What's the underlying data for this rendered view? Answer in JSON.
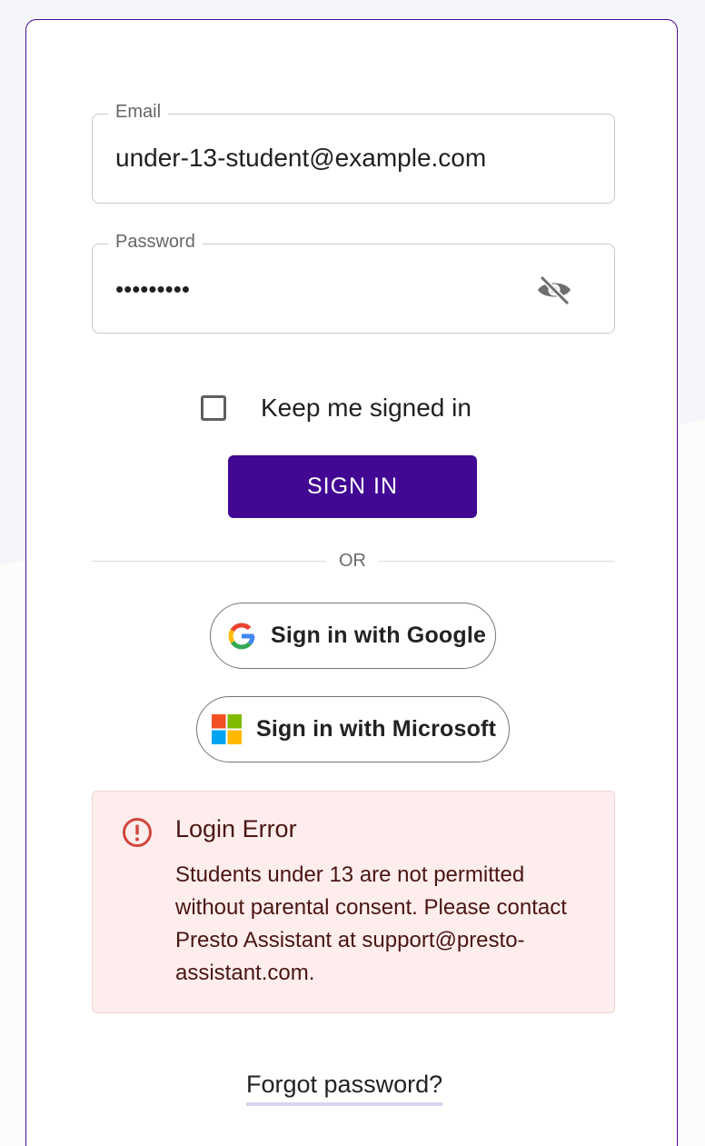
{
  "form": {
    "email_label": "Email",
    "email_value": "under-13-student@example.com",
    "password_label": "Password",
    "password_mask": "•••••••••",
    "password_toggle_icon": "eye-off-icon",
    "keep_signed_in_label": "Keep me signed in",
    "keep_signed_in_checked": false,
    "sign_in_label": "SIGN IN",
    "divider_label": "OR"
  },
  "oauth": {
    "google_label": "Sign in with Google",
    "google_icon": "google-g-logo",
    "microsoft_label": "Sign in with Microsoft",
    "microsoft_icon": "microsoft-logo"
  },
  "alert": {
    "icon": "error-circle-icon",
    "title": "Login Error",
    "message": "Students under 13 are not permitted without parental consent. Please contact Presto Assistant at support@presto-assistant.com."
  },
  "links": {
    "forgot_password": "Forgot password?"
  },
  "colors": {
    "primary": "#420894",
    "card_border": "#4b0a8e",
    "error_bg": "#fdeeed",
    "error_icon": "#d2463d",
    "error_text": "#4a1512"
  }
}
